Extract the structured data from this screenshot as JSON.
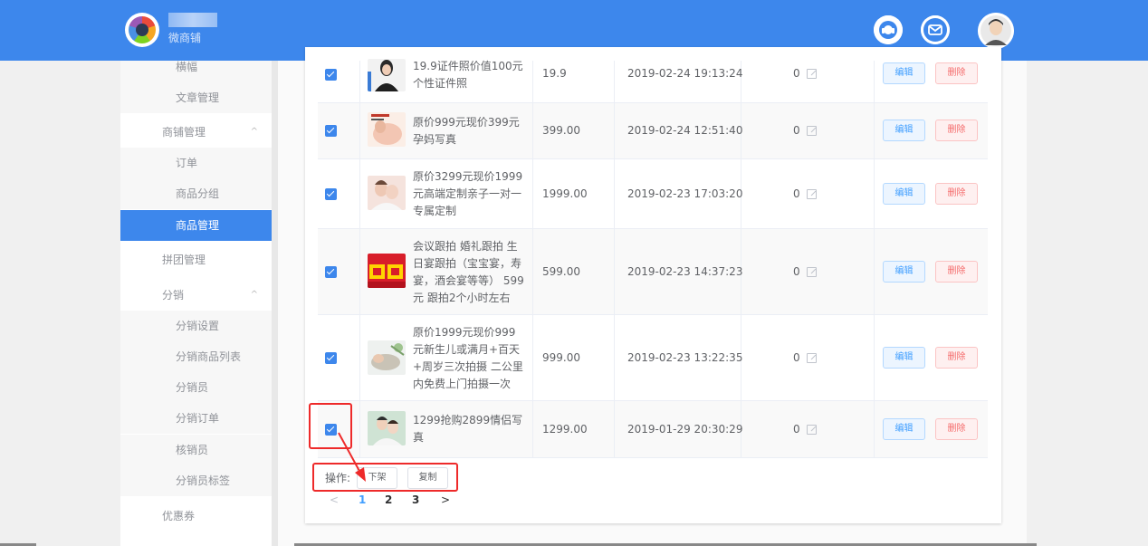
{
  "header": {
    "brand": "微商铺",
    "colors": {
      "header_bg": "#3d87ec",
      "accent": "#3d87ec",
      "danger": "#f56c6c"
    }
  },
  "sidebar": {
    "items": [
      {
        "label": "横幅",
        "type": "sub"
      },
      {
        "label": "文章管理",
        "type": "sub"
      },
      {
        "label": "商铺管理",
        "type": "group",
        "caret": "^"
      },
      {
        "label": "订单",
        "type": "sub"
      },
      {
        "label": "商品分组",
        "type": "sub"
      },
      {
        "label": "商品管理",
        "type": "sub",
        "active": true
      },
      {
        "label": "拼团管理",
        "type": "group"
      },
      {
        "label": "分销",
        "type": "group",
        "caret": "^"
      },
      {
        "label": "分销设置",
        "type": "sub"
      },
      {
        "label": "分销商品列表",
        "type": "sub"
      },
      {
        "label": "分销员",
        "type": "sub"
      },
      {
        "label": "分销订单",
        "type": "sub"
      },
      {
        "label": "核销员",
        "type": "sub"
      },
      {
        "label": "分销员标签",
        "type": "sub"
      },
      {
        "label": "优惠券",
        "type": "group"
      }
    ]
  },
  "products": [
    {
      "title": "19.9证件照价值100元 个性证件照",
      "price": "19.9",
      "date": "2019-02-24 19:13:24",
      "stock": "0",
      "edit": "编辑",
      "delete": "删除",
      "checked": true
    },
    {
      "title": "原价999元现价399元 孕妈写真",
      "price": "399.00",
      "date": "2019-02-24 12:51:40",
      "stock": "0",
      "edit": "编辑",
      "delete": "删除",
      "checked": true
    },
    {
      "title": "原价3299元现价1999元高端定制亲子一对一专属定制",
      "price": "1999.00",
      "date": "2019-02-23 17:03:20",
      "stock": "0",
      "edit": "编辑",
      "delete": "删除",
      "checked": true
    },
    {
      "title": "会议跟拍 婚礼跟拍 生日宴跟拍（宝宝宴，寿宴，酒会宴等等） 599元 跟拍2个小时左右",
      "price": "599.00",
      "date": "2019-02-23 14:37:23",
      "stock": "0",
      "edit": "编辑",
      "delete": "删除",
      "checked": true
    },
    {
      "title": "原价1999元现价999元新生儿或满月+百天+周岁三次拍摄 二公里内免费上门拍摄一次",
      "price": "999.00",
      "date": "2019-02-23 13:22:35",
      "stock": "0",
      "edit": "编辑",
      "delete": "删除",
      "checked": true
    },
    {
      "title": "1299抢购2899情侣写真",
      "price": "1299.00",
      "date": "2019-01-29 20:30:29",
      "stock": "0",
      "edit": "编辑",
      "delete": "删除",
      "checked": true
    }
  ],
  "operations": {
    "label": "操作:",
    "offshelf": "下架",
    "copy": "复制"
  },
  "pagination": {
    "prev": "<",
    "pages": [
      "1",
      "2",
      "3"
    ],
    "current": "1",
    "next": ">"
  }
}
